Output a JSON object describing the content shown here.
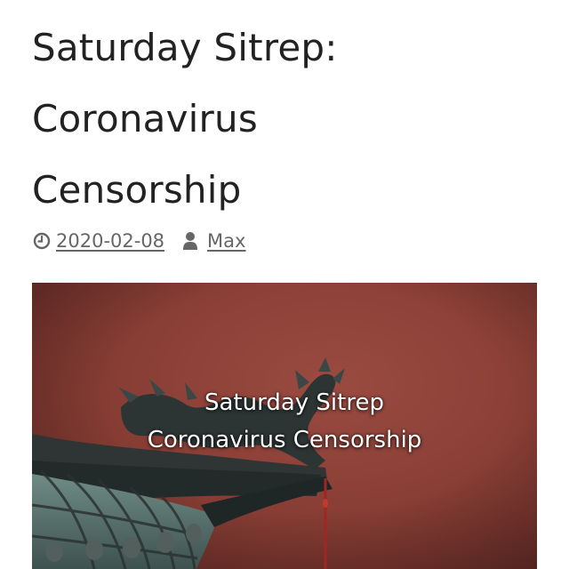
{
  "post": {
    "title_lines": [
      "Saturday Sitrep:",
      "Coronavirus",
      "Censorship"
    ],
    "date": "2020-02-08",
    "author": "Max",
    "date_icon": "clock-icon",
    "author_icon": "user-icon"
  },
  "hero": {
    "caption_line1": "Saturday Sitrep",
    "caption_line2": "Coronavirus Censorship",
    "background_color": "#8a3f36"
  }
}
